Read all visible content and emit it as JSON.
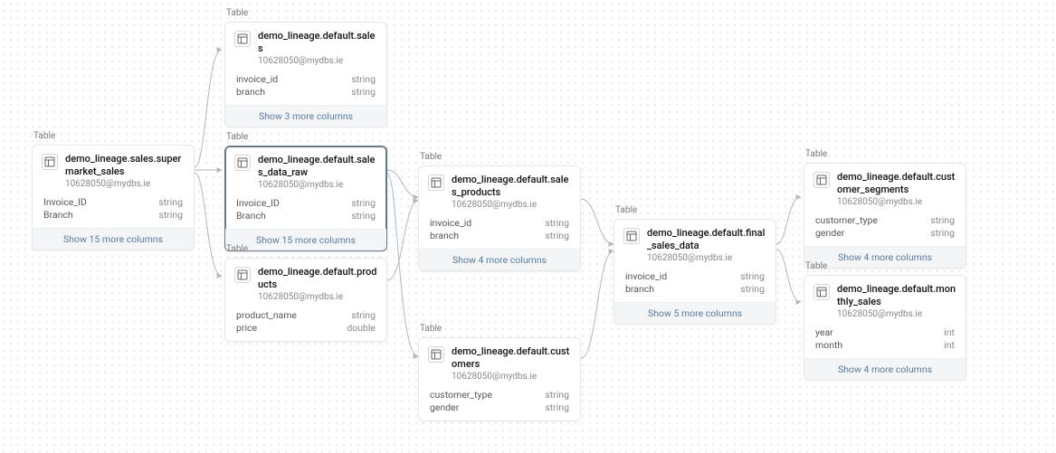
{
  "type_label": "Table",
  "nodes": {
    "supermarket_sales": {
      "title": "demo_lineage.sales.supermarket_sales",
      "subtitle": "10628050@mydbs.ie",
      "columns": [
        {
          "name": "Invoice_ID",
          "type": "string"
        },
        {
          "name": "Branch",
          "type": "string"
        }
      ],
      "more": "Show 15 more columns"
    },
    "sales": {
      "title": "demo_lineage.default.sales",
      "subtitle": "10628050@mydbs.ie",
      "columns": [
        {
          "name": "invoice_id",
          "type": "string"
        },
        {
          "name": "branch",
          "type": "string"
        }
      ],
      "more": "Show 3 more columns"
    },
    "sales_data_raw": {
      "title": "demo_lineage.default.sales_data_raw",
      "subtitle": "10628050@mydbs.ie",
      "columns": [
        {
          "name": "Invoice_ID",
          "type": "string"
        },
        {
          "name": "Branch",
          "type": "string"
        }
      ],
      "more": "Show 15 more columns"
    },
    "products": {
      "title": "demo_lineage.default.products",
      "subtitle": "10628050@mydbs.ie",
      "columns": [
        {
          "name": "product_name",
          "type": "string"
        },
        {
          "name": "price",
          "type": "double"
        }
      ]
    },
    "sales_products": {
      "title": "demo_lineage.default.sales_products",
      "subtitle": "10628050@mydbs.ie",
      "columns": [
        {
          "name": "invoice_id",
          "type": "string"
        },
        {
          "name": "branch",
          "type": "string"
        }
      ],
      "more": "Show 4 more columns"
    },
    "customers": {
      "title": "demo_lineage.default.customers",
      "subtitle": "10628050@mydbs.ie",
      "columns": [
        {
          "name": "customer_type",
          "type": "string"
        },
        {
          "name": "gender",
          "type": "string"
        }
      ]
    },
    "final_sales_data": {
      "title": "demo_lineage.default.final_sales_data",
      "subtitle": "10628050@mydbs.ie",
      "columns": [
        {
          "name": "invoice_id",
          "type": "string"
        },
        {
          "name": "branch",
          "type": "string"
        }
      ],
      "more": "Show 5 more columns"
    },
    "customer_segments": {
      "title": "demo_lineage.default.customer_segments",
      "subtitle": "10628050@mydbs.ie",
      "columns": [
        {
          "name": "customer_type",
          "type": "string"
        },
        {
          "name": "gender",
          "type": "string"
        }
      ],
      "more": "Show 4 more columns"
    },
    "monthly_sales": {
      "title": "demo_lineage.default.monthly_sales",
      "subtitle": "10628050@mydbs.ie",
      "columns": [
        {
          "name": "year",
          "type": "int"
        },
        {
          "name": "month",
          "type": "int"
        }
      ],
      "more": "Show 4 more columns"
    }
  }
}
